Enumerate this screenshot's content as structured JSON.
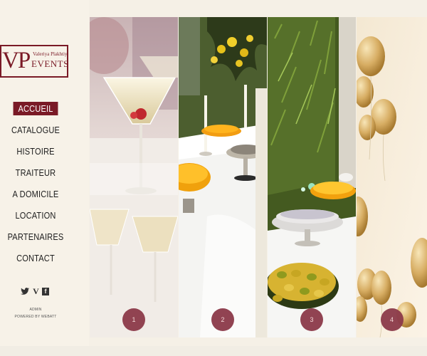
{
  "logo": {
    "initials": "VP",
    "name": "Valeriya Plakhtiy",
    "tagline": "EVENTS"
  },
  "nav": {
    "items": [
      {
        "label": "ACCUEIL",
        "active": true
      },
      {
        "label": "CATALOGUE",
        "active": false
      },
      {
        "label": "HISTOIRE",
        "active": false
      },
      {
        "label": "TRAITEUR",
        "active": false
      },
      {
        "label": "A DOMICILE",
        "active": false
      },
      {
        "label": "LOCATION",
        "active": false
      },
      {
        "label": "PARTENAIRES",
        "active": false
      },
      {
        "label": "CONTACT",
        "active": false
      }
    ]
  },
  "social": {
    "icons": [
      "twitter-icon",
      "vimeo-icon",
      "facebook-icon"
    ]
  },
  "footer": {
    "admin": "ADMIN",
    "powered": "POWERED BY WEBATT"
  },
  "gallery": {
    "panels": [
      {
        "number": "1",
        "subject": "champagne glasses"
      },
      {
        "number": "2",
        "subject": "buffet table with flowers"
      },
      {
        "number": "3",
        "subject": "dessert plates"
      },
      {
        "number": "4",
        "subject": "gold balloons"
      }
    ]
  },
  "colors": {
    "accent": "#7a1a26",
    "number_circle": "#8c3a4a",
    "background": "#f5f0e6"
  }
}
